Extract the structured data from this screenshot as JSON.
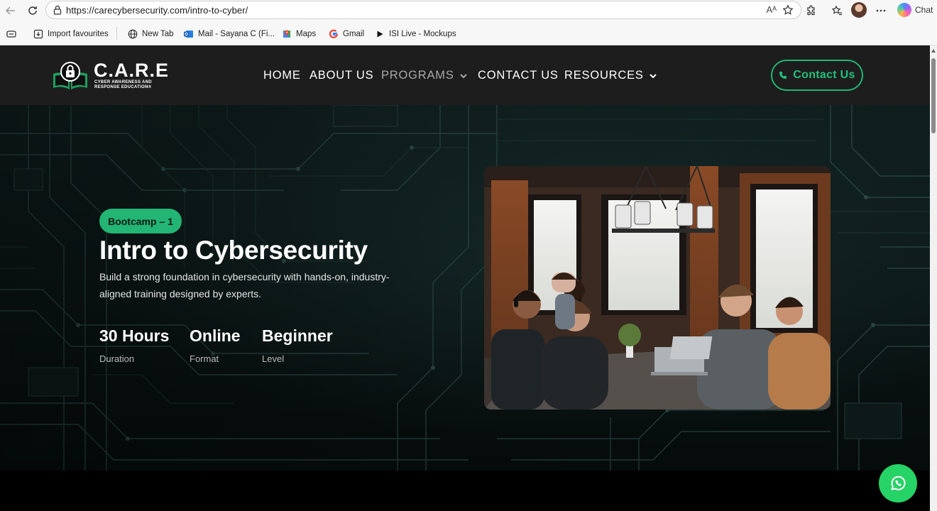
{
  "browser": {
    "url": "https://carecybersecurity.com/intro-to-cyber/",
    "read_aloud": "Aᴬ",
    "chat_label": "Chat",
    "bookmarks": [
      {
        "label": "Import favourites",
        "icon": "import-icon"
      },
      {
        "label": "New Tab",
        "icon": "globe-icon"
      },
      {
        "label": "Mail - Sayana C (Fi...",
        "icon": "outlook-icon"
      },
      {
        "label": "Maps",
        "icon": "maps-icon"
      },
      {
        "label": "Gmail",
        "icon": "google-icon"
      },
      {
        "label": "ISI Live - Mockups",
        "icon": "play-icon"
      }
    ]
  },
  "site": {
    "logo": {
      "title": "C.A.R.E",
      "subtitle": "CYBER AWARENESS AND RESPONSE EDUCATION®"
    },
    "nav": {
      "home": "HOME",
      "about": "ABOUT US",
      "programs": "PROGRAMS",
      "contact": "CONTACT US",
      "resources": "RESOURCES"
    },
    "contact_button": "Contact Us",
    "accent_color": "#22b573"
  },
  "hero": {
    "badge": "Bootcamp – 1",
    "title": "Intro to Cybersecurity",
    "description": "Build a strong foundation in cybersecurity with hands-on, industry-aligned training designed by experts.",
    "stats": [
      {
        "value": "30 Hours",
        "label": "Duration"
      },
      {
        "value": "Online",
        "label": "Format"
      },
      {
        "value": "Beginner",
        "label": "Level"
      }
    ]
  }
}
